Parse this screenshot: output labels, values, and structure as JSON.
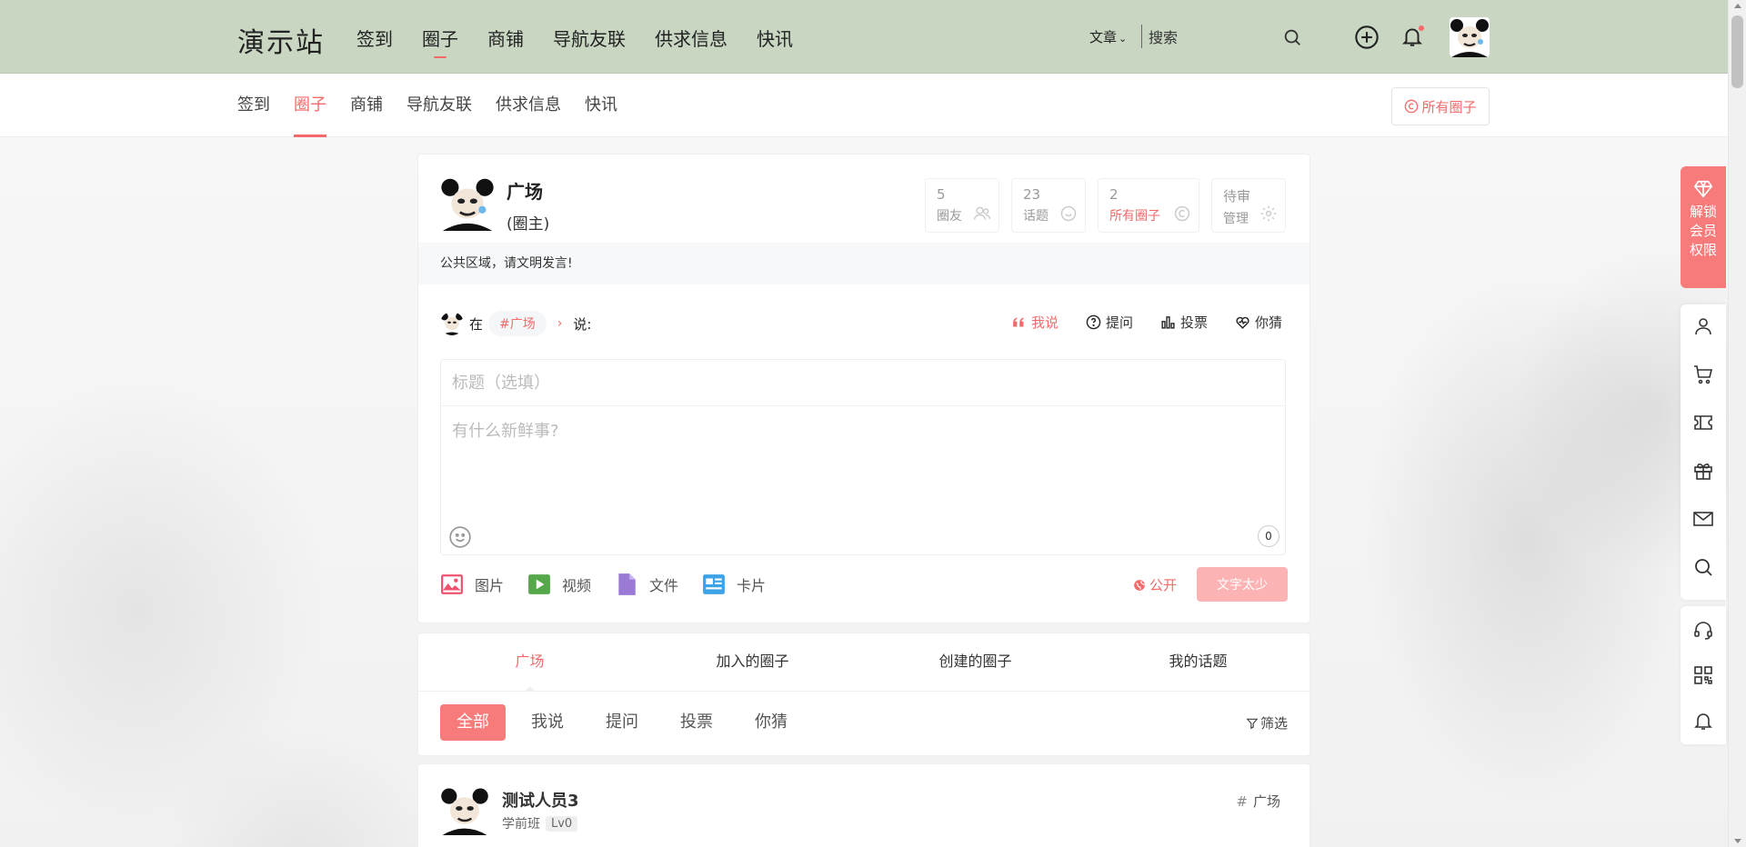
{
  "header": {
    "site_name": "演示站",
    "nav": [
      "签到",
      "圈子",
      "商铺",
      "导航友联",
      "供求信息",
      "快讯"
    ],
    "search_type": "文章",
    "search_placeholder": "搜索"
  },
  "subnav": {
    "items": [
      "签到",
      "圈子",
      "商铺",
      "导航友联",
      "供求信息",
      "快讯"
    ],
    "all_circles": "所有圈子"
  },
  "circle": {
    "name": "广场",
    "role": "(圈主)",
    "stats": [
      {
        "num": "5",
        "label": "圈友"
      },
      {
        "num": "23",
        "label": "话题"
      },
      {
        "num": "2",
        "label": "所有圈子"
      },
      {
        "num": "待审",
        "label": "管理"
      }
    ],
    "notice": "公共区域，请文明发言!"
  },
  "composer": {
    "in_label": "在",
    "topic": "#广场",
    "say_label": "说:",
    "post_types": [
      "我说",
      "提问",
      "投票",
      "你猜"
    ],
    "title_placeholder": "标题（选填）",
    "content_placeholder": "有什么新鲜事?",
    "char_count": "0",
    "attachments": [
      "图片",
      "视频",
      "文件",
      "卡片"
    ],
    "visibility": "公开",
    "submit": "文字太少"
  },
  "tabs": {
    "main": [
      "广场",
      "加入的圈子",
      "创建的圈子",
      "我的话题"
    ],
    "filters": [
      "全部",
      "我说",
      "提问",
      "投票",
      "你猜"
    ],
    "filter_btn": "筛选"
  },
  "post": {
    "author": "测试人员3",
    "grade": "学前班",
    "level": "Lv0",
    "topic": "广场"
  },
  "sidebar": {
    "vip": "解锁会员权限"
  },
  "colors": {
    "accent": "#f36a6a",
    "header_bg": "#c9d6c2"
  }
}
